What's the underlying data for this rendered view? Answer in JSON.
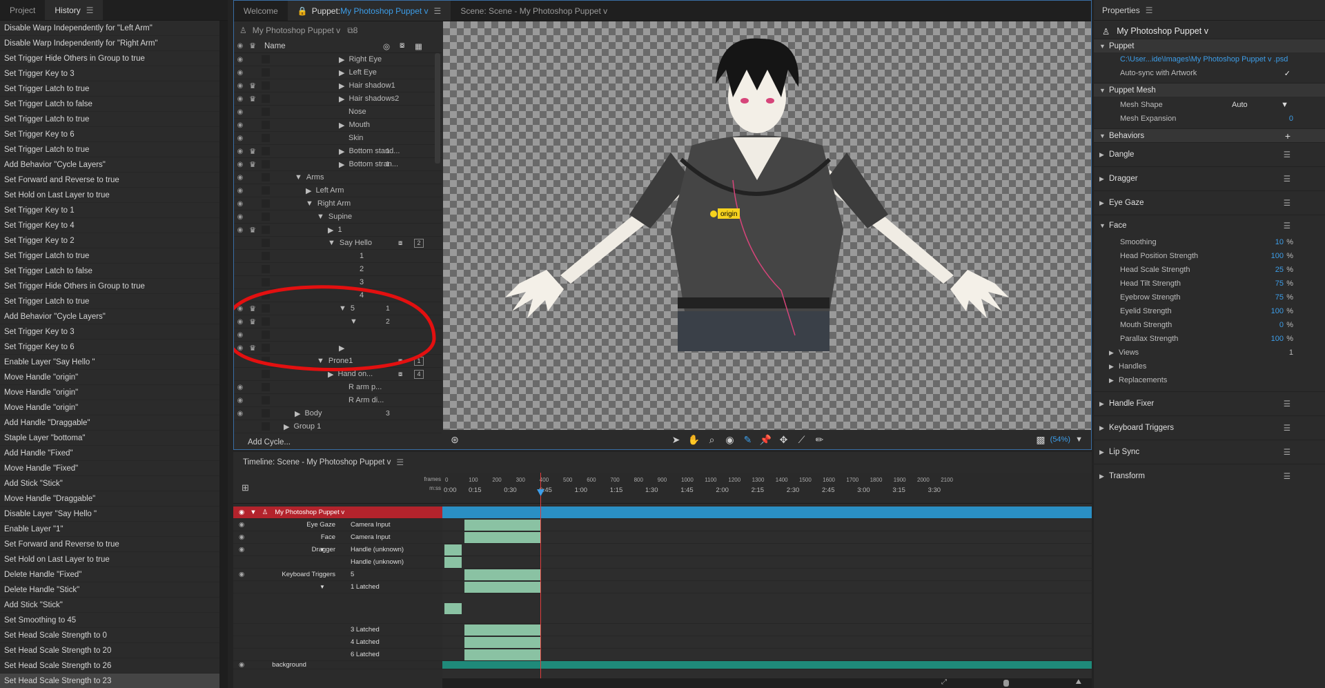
{
  "history": {
    "tabs": [
      "Project",
      "History"
    ],
    "items": [
      "Disable Warp Independently for \"Left Arm\"",
      "Disable Warp Independently for \"Right Arm\"",
      "Set Trigger Hide Others in Group to true",
      "Set Trigger Key to 3",
      "Set Trigger Latch to true",
      "Set Trigger Latch to false",
      "Set Trigger Latch to true",
      "Set Trigger Key to 6",
      "Set Trigger Latch to true",
      "Add Behavior \"Cycle Layers\"",
      "Set Forward and Reverse to true",
      "Set Hold on Last Layer to true",
      "Set Trigger Key to 1",
      "Set Trigger Key to 4",
      "Set Trigger Key to 2",
      "Set Trigger Latch to true",
      "Set Trigger Latch to false",
      "Set Trigger Hide Others in Group to true",
      "Set Trigger Latch to true",
      "Add Behavior \"Cycle Layers\"",
      "Set Trigger Key to 3",
      "Set Trigger Key to 6",
      "Enable Layer \"Say Hello \"",
      "Move Handle \"origin\"",
      "Move Handle \"origin\"",
      "Move Handle \"origin\"",
      "Add Handle \"Draggable\"",
      "Staple Layer \"bottoma\"",
      "Add Handle \"Fixed\"",
      "Move Handle \"Fixed\"",
      "Add Stick \"Stick\"",
      "Move Handle \"Draggable\"",
      "Disable Layer \"Say Hello \"",
      "Enable Layer \"1\"",
      "Set Forward and Reverse to true",
      "Set Hold on Last Layer to true",
      "Delete Handle \"Fixed\"",
      "Delete Handle \"Stick\"",
      "Add Stick \"Stick\"",
      "Set Smoothing to 45",
      "Set Head Scale Strength to 0",
      "Set Head Scale Strength to 20",
      "Set Head Scale Strength to 26",
      "Set Head Scale Strength to 23"
    ]
  },
  "tabs": {
    "welcome": "Welcome",
    "puppet_prefix": "Puppet: ",
    "puppet_name": "My Photoshop Puppet v",
    "scene": "Scene: Scene - My Photoshop Puppet v"
  },
  "tree": {
    "header": "My Photoshop Puppet v",
    "badge": "8",
    "name_col": "Name",
    "rows": [
      {
        "n": "Right Eye",
        "i": 6,
        "c": false,
        "num": ""
      },
      {
        "n": "Left Eye",
        "i": 6,
        "c": false,
        "num": ""
      },
      {
        "n": "Hair shadow1",
        "i": 6,
        "c": true,
        "num": ""
      },
      {
        "n": "Hair shadows2",
        "i": 6,
        "c": true,
        "num": ""
      },
      {
        "n": "Nose",
        "i": 6,
        "c": false,
        "num": "",
        "nt": true
      },
      {
        "n": "Mouth",
        "i": 6,
        "c": false,
        "num": ""
      },
      {
        "n": "Skin",
        "i": 6,
        "c": false,
        "num": "",
        "nt": true
      },
      {
        "n": "Bottom stand...",
        "i": 6,
        "c": true,
        "num": "1"
      },
      {
        "n": "Bottom stran...",
        "i": 6,
        "c": true,
        "num": "1"
      },
      {
        "n": "Arms",
        "i": 2,
        "c": false,
        "num": "",
        "open": true
      },
      {
        "n": "Left Arm",
        "i": 3,
        "c": false,
        "num": ""
      },
      {
        "n": "Right Arm",
        "i": 3,
        "c": false,
        "num": "",
        "open": true
      },
      {
        "n": "Supine",
        "i": 4,
        "c": false,
        "num": "",
        "open": true
      },
      {
        "n": "1",
        "i": 5,
        "c": true,
        "num": ""
      },
      {
        "n": "Say Hello",
        "i": 5,
        "c": false,
        "num": "",
        "open": true,
        "b2": "2",
        "noeye": true
      },
      {
        "n": "1",
        "i": 7,
        "c": false,
        "num": "",
        "nt": true,
        "noeye": true
      },
      {
        "n": "2",
        "i": 7,
        "c": false,
        "num": "",
        "nt": true,
        "noeye": true
      },
      {
        "n": "3",
        "i": 7,
        "c": false,
        "num": "",
        "nt": true,
        "noeye": true
      },
      {
        "n": "4",
        "i": 7,
        "c": false,
        "num": "",
        "nt": true,
        "noeye": true
      },
      {
        "n": "5",
        "i": 6,
        "c": true,
        "num": "1",
        "open": true
      },
      {
        "n": "",
        "i": 7,
        "c": true,
        "num": "2",
        "open": true
      },
      {
        "n": "",
        "i": 2,
        "c": false,
        "num": "",
        "nt": true
      },
      {
        "n": "",
        "i": 6,
        "c": true,
        "num": ""
      },
      {
        "n": "Prone1",
        "i": 4,
        "c": false,
        "num": "",
        "open": true,
        "b2": "1",
        "noeye": true
      },
      {
        "n": "Hand on...",
        "i": 5,
        "c": false,
        "num": "",
        "b2": "4",
        "noeye": true
      },
      {
        "n": "R arm p...",
        "i": 6,
        "c": false,
        "num": "",
        "nt": true
      },
      {
        "n": "R Arm di...",
        "i": 6,
        "c": false,
        "num": "",
        "nt": true
      },
      {
        "n": "Body",
        "i": 2,
        "c": false,
        "num": "3"
      },
      {
        "n": "Group 1",
        "i": 1,
        "c": false,
        "num": "",
        "noeye": true
      }
    ],
    "add_cycle": "Add Cycle..."
  },
  "canvas": {
    "handle_label": "origin",
    "zoom": "(54%)"
  },
  "timeline": {
    "title": "Timeline: Scene - My Photoshop Puppet v",
    "frames_label": "frames",
    "mss_label": "m:ss",
    "frame_ticks": [
      "0",
      "100",
      "200",
      "300",
      "400",
      "500",
      "600",
      "700",
      "800",
      "900",
      "1000",
      "1100",
      "1200",
      "1300",
      "1400",
      "1500",
      "1600",
      "1700",
      "1800",
      "1900",
      "2000",
      "2100"
    ],
    "time_ticks": [
      "0:00",
      "0:15",
      "0:30",
      "0:45",
      "1:00",
      "1:15",
      "1:30",
      "1:45",
      "2:00",
      "2:15",
      "2:30",
      "2:45",
      "3:00",
      "3:15",
      "3:30"
    ],
    "puppet_row": "My Photoshop Puppet v",
    "rows": [
      {
        "label": "Eye Gaze",
        "val": "Camera Input"
      },
      {
        "label": "Face",
        "val": "Camera Input"
      },
      {
        "label": "Dragger",
        "val": "Handle (unknown)"
      },
      {
        "label": "",
        "val": "Handle (unknown)"
      },
      {
        "label": "Keyboard Triggers",
        "val": "5"
      },
      {
        "label": "",
        "val": "1 Latched"
      },
      {
        "label": "",
        "val": ""
      },
      {
        "label": "",
        "val": "3 Latched"
      },
      {
        "label": "",
        "val": "4 Latched"
      },
      {
        "label": "",
        "val": "6 Latched"
      }
    ],
    "background_row": "background"
  },
  "props": {
    "header": "Properties",
    "title": "My Photoshop Puppet v",
    "puppet_section": "Puppet",
    "file_path": "C:\\User...ide\\Images\\My Photoshop Puppet v .psd",
    "autosync": "Auto-sync with Artwork",
    "autosync_check": "✓",
    "mesh_section": "Puppet Mesh",
    "mesh_shape_label": "Mesh Shape",
    "mesh_shape": "Auto",
    "mesh_exp_label": "Mesh Expansion",
    "mesh_exp": "0",
    "behaviors_section": "Behaviors",
    "behaviors": [
      "Dangle",
      "Dragger",
      "Eye Gaze"
    ],
    "face": "Face",
    "face_params": [
      {
        "l": "Smoothing",
        "v": "10"
      },
      {
        "l": "Head Position Strength",
        "v": "100"
      },
      {
        "l": "Head Scale Strength",
        "v": "25"
      },
      {
        "l": "Head Tilt Strength",
        "v": "75"
      },
      {
        "l": "Eyebrow Strength",
        "v": "75"
      },
      {
        "l": "Eyelid Strength",
        "v": "100"
      },
      {
        "l": "Mouth Strength",
        "v": "0"
      },
      {
        "l": "Parallax Strength",
        "v": "100"
      }
    ],
    "pct": "%",
    "views": "Views",
    "views_val": "1",
    "handles": "Handles",
    "replacements": "Replacements",
    "behaviors2": [
      "Handle Fixer",
      "Keyboard Triggers",
      "Lip Sync",
      "Transform"
    ]
  },
  "colors": {
    "accent": "#3d9ee9",
    "puppet_row": "#b3232c",
    "bar": "#8ac2a3",
    "track": "#2a8fc4",
    "annotation": "#e31010"
  }
}
